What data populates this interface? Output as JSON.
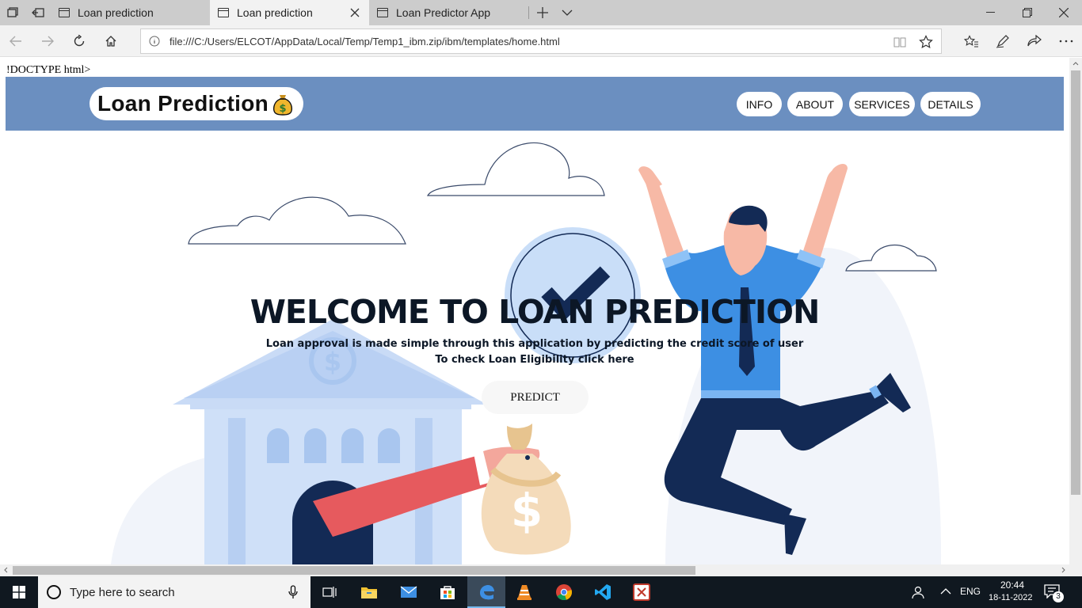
{
  "browser": {
    "tabs": [
      {
        "label": "Loan prediction",
        "active": false
      },
      {
        "label": "Loan prediction",
        "active": true
      },
      {
        "label": "Loan Predictor App",
        "active": false
      }
    ],
    "url": "file:///C:/Users/ELCOT/AppData/Local/Temp/Temp1_ibm.zip/ibm/templates/home.html"
  },
  "page": {
    "doctype_text": "!DOCTYPE html>",
    "brand": "Loan Prediction",
    "nav": [
      "INFO",
      "ABOUT",
      "SERVICES",
      "DETAILS"
    ],
    "hero": {
      "title": "WELCOME TO LOAN PREDICTION",
      "subtitle_1": "Loan approval is made simple through this application by predicting the credit score of user",
      "subtitle_2": "To check Loan Eligibility click here",
      "button": "PREDICT"
    }
  },
  "taskbar": {
    "search_placeholder": "Type here to search",
    "language": "ENG",
    "time": "20:44",
    "date": "18-11-2022",
    "notification_count": "3"
  },
  "colors": {
    "navbar": "#6b8fc0",
    "title": "#0c1726",
    "taskbar": "#101820"
  }
}
